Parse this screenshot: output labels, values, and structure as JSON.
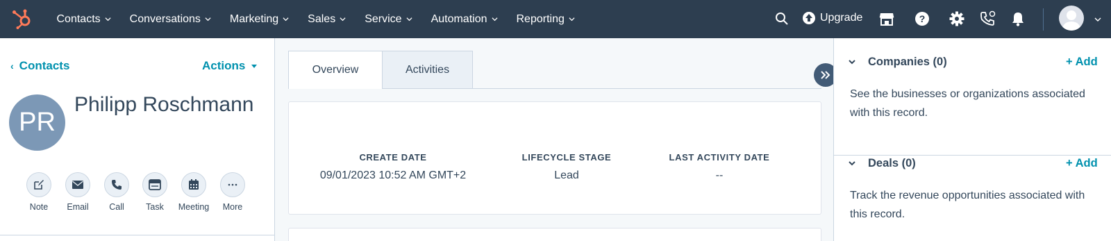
{
  "nav": {
    "items": [
      {
        "label": "Contacts"
      },
      {
        "label": "Conversations"
      },
      {
        "label": "Marketing"
      },
      {
        "label": "Sales"
      },
      {
        "label": "Service"
      },
      {
        "label": "Automation"
      },
      {
        "label": "Reporting"
      }
    ],
    "upgrade_label": "Upgrade"
  },
  "left": {
    "back_label": "Contacts",
    "actions_label": "Actions",
    "avatar_initials": "PR",
    "contact_name": "Philipp Roschmann",
    "quick_actions": [
      {
        "label": "Note",
        "icon": "edit-icon"
      },
      {
        "label": "Email",
        "icon": "email-icon"
      },
      {
        "label": "Call",
        "icon": "phone-icon"
      },
      {
        "label": "Task",
        "icon": "task-icon"
      },
      {
        "label": "Meeting",
        "icon": "calendar-icon"
      },
      {
        "label": "More",
        "icon": "more-icon"
      }
    ]
  },
  "middle": {
    "tabs": [
      {
        "label": "Overview"
      },
      {
        "label": "Activities"
      }
    ],
    "stats": [
      {
        "label": "CREATE DATE",
        "value": "09/01/2023 10:52 AM GMT+2"
      },
      {
        "label": "LIFECYCLE STAGE",
        "value": "Lead"
      },
      {
        "label": "LAST ACTIVITY DATE",
        "value": "--"
      }
    ]
  },
  "right": {
    "sections": [
      {
        "title": "Companies (0)",
        "add_label": "+ Add",
        "description": "See the businesses or organizations associated with this record."
      },
      {
        "title": "Deals (0)",
        "add_label": "+ Add",
        "description": "Track the revenue opportunities associated with this record."
      }
    ]
  },
  "colors": {
    "nav_bg": "#2d3e50",
    "link": "#0091ae",
    "brand_orange": "#ff7a59",
    "avatar_bg": "#7c98b6"
  }
}
